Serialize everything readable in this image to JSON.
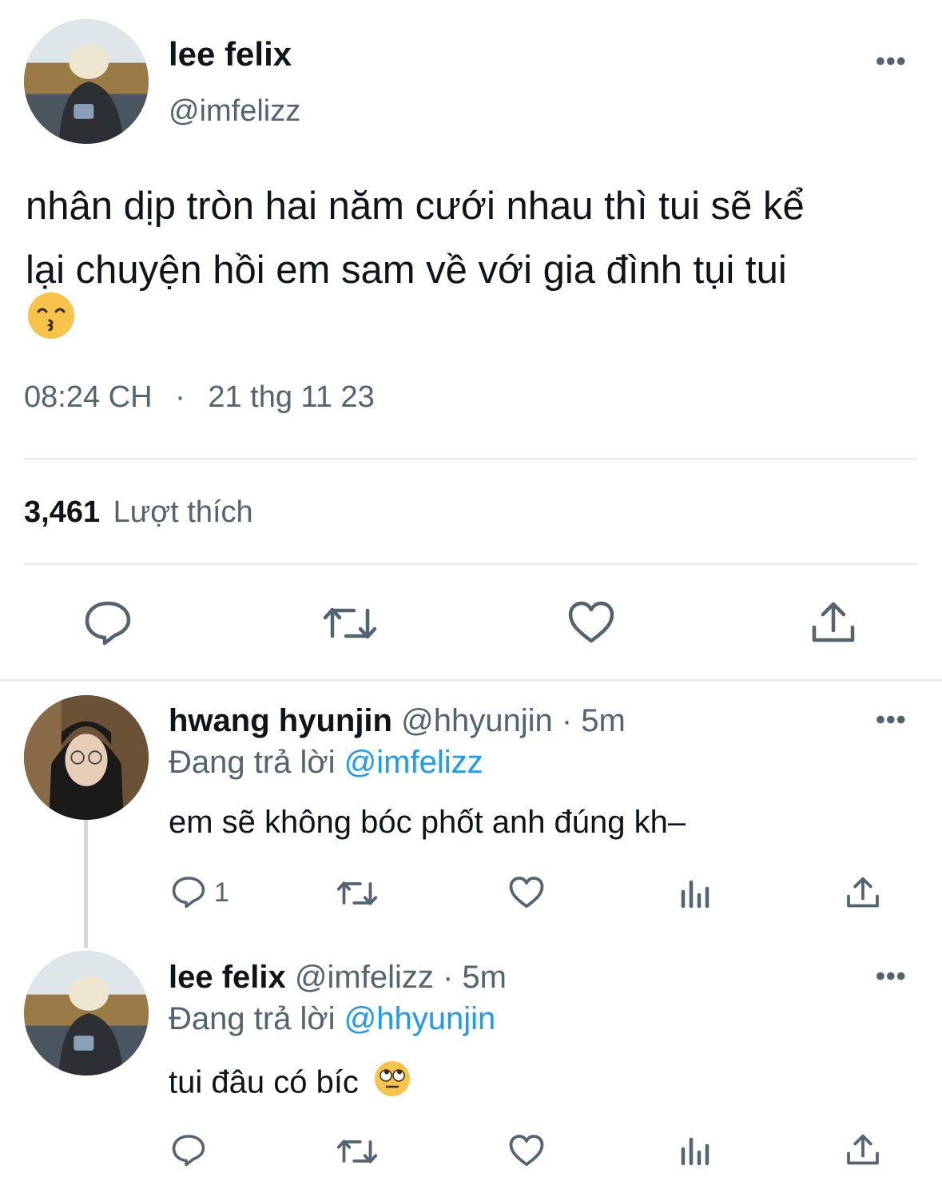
{
  "main_tweet": {
    "display_name": "lee felix",
    "handle": "@imfelizz",
    "text_line1": "nhân dịp tròn hai năm cưới nhau thì tui sẽ kể",
    "text_line2": "lại chuyện hồi em sam về với gia đình tụi tui",
    "emoji_icon": "kissing-face-smiling-eyes-emoji",
    "time": "08:24 CH",
    "separator": "·",
    "date": "21 thg 11 23",
    "likes_count": "3,461",
    "likes_label": "Lượt thích",
    "more_label": "•••"
  },
  "replies": [
    {
      "display_name": "hwang hyunjin",
      "handle": "@hhyunjin",
      "meta": "· 5m",
      "replying_label": "Đang trả lời",
      "replying_to": "@imfelizz",
      "text": "em sẽ không bóc phốt anh đúng kh–",
      "reply_count": "1",
      "more_label": "•••"
    },
    {
      "display_name": "lee felix",
      "handle": "@imfelizz",
      "meta": "· 5m",
      "replying_label": "Đang trả lời",
      "replying_to": "@hhyunjin",
      "text": "tui đâu có bíc",
      "emoji_icon": "face-with-rolling-eyes-emoji",
      "more_label": "•••"
    }
  ],
  "colors": {
    "text": "#0f1419",
    "secondary": "#536471",
    "link": "#1d9bf0",
    "divider": "#e7eaed",
    "emoji": "#f7c34a"
  }
}
